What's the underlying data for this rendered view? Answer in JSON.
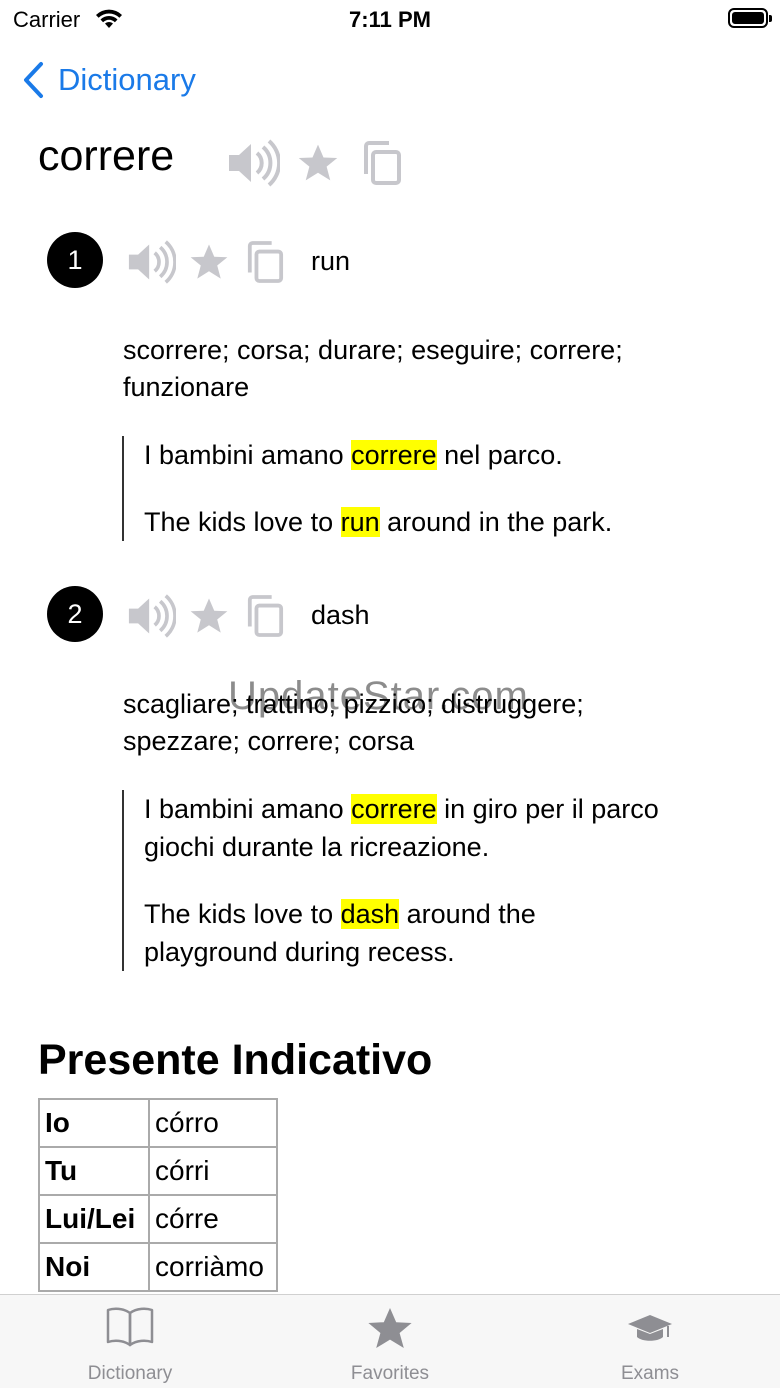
{
  "status": {
    "carrier": "Carrier",
    "time": "7:11 PM"
  },
  "nav": {
    "back_label": "Dictionary"
  },
  "entry": {
    "word": "correre",
    "senses": [
      {
        "number": "1",
        "gloss": "run",
        "synonyms": "scorrere; corsa; durare; eseguire; correre; funzionare",
        "example_it": {
          "before": "I bambini amano ",
          "highlight": "correre",
          "after": " nel parco."
        },
        "example_en": {
          "before": "The kids love to ",
          "highlight": "run",
          "after": " around in the park."
        }
      },
      {
        "number": "2",
        "gloss": "dash",
        "synonyms": "scagliare; trattino; pizzico; distruggere; spezzare; correre; corsa",
        "example_it": {
          "before": "I bambini amano ",
          "highlight": "correre",
          "after": " in giro per il parco giochi durante la ricreazione."
        },
        "example_en": {
          "before": "The kids love to ",
          "highlight": "dash",
          "after": " around the playground during recess."
        }
      }
    ]
  },
  "conjugation": {
    "title": "Presente Indicativo",
    "rows": [
      {
        "pronoun": "Io",
        "form": "córro"
      },
      {
        "pronoun": "Tu",
        "form": "córri"
      },
      {
        "pronoun": "Lui/Lei",
        "form": "córre"
      },
      {
        "pronoun": "Noi",
        "form": "corriàmo"
      }
    ]
  },
  "watermark": "UpdateStar.com",
  "tabs": [
    {
      "label": "Dictionary",
      "icon": "book-icon"
    },
    {
      "label": "Favorites",
      "icon": "star-icon"
    },
    {
      "label": "Exams",
      "icon": "graduation-cap-icon"
    }
  ],
  "colors": {
    "accent": "#1a7ae8",
    "highlight": "#ffff00",
    "icon_gray": "#c7c7cc",
    "tab_gray": "#8e8e93"
  }
}
